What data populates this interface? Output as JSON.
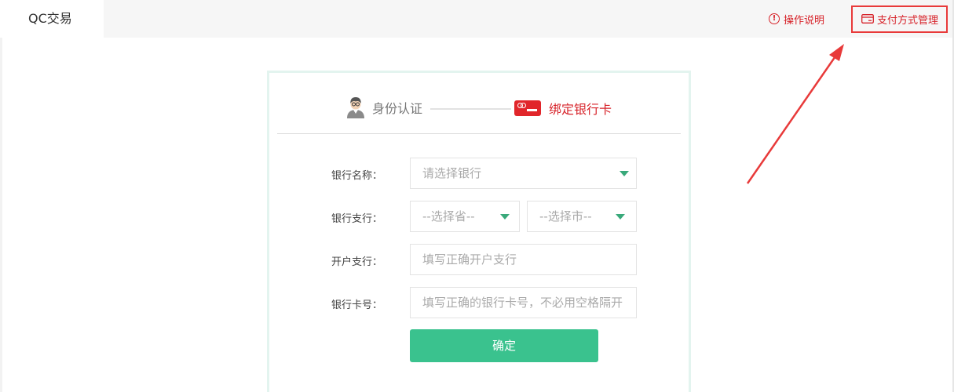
{
  "topbar": {
    "active_tab": "QC交易",
    "help_icon": "info-circle-icon",
    "help_link": "操作说明",
    "pay_icon": "credit-card-icon",
    "pay_link": "支付方式管理",
    "accent_color": "#d7232a",
    "highlight_color": "#e83a3a"
  },
  "steps": {
    "step1_icon": "user-avatar-icon",
    "step1_label": "身份认证",
    "step2_icon": "bank-card-icon",
    "step2_label": "绑定银行卡"
  },
  "form": {
    "bank_name_label": "银行名称：",
    "bank_name_value": "请选择银行",
    "branch_label": "银行支行：",
    "province_value": "--选择省--",
    "city_value": "--选择市--",
    "account_branch_label": "开户支行：",
    "account_branch_placeholder": "填写正确开户支行",
    "card_no_label": "银行卡号：",
    "card_no_placeholder": "填写正确的银行卡号，不必用空格隔开",
    "submit_label": "确定",
    "button_color": "#3ac28e"
  }
}
